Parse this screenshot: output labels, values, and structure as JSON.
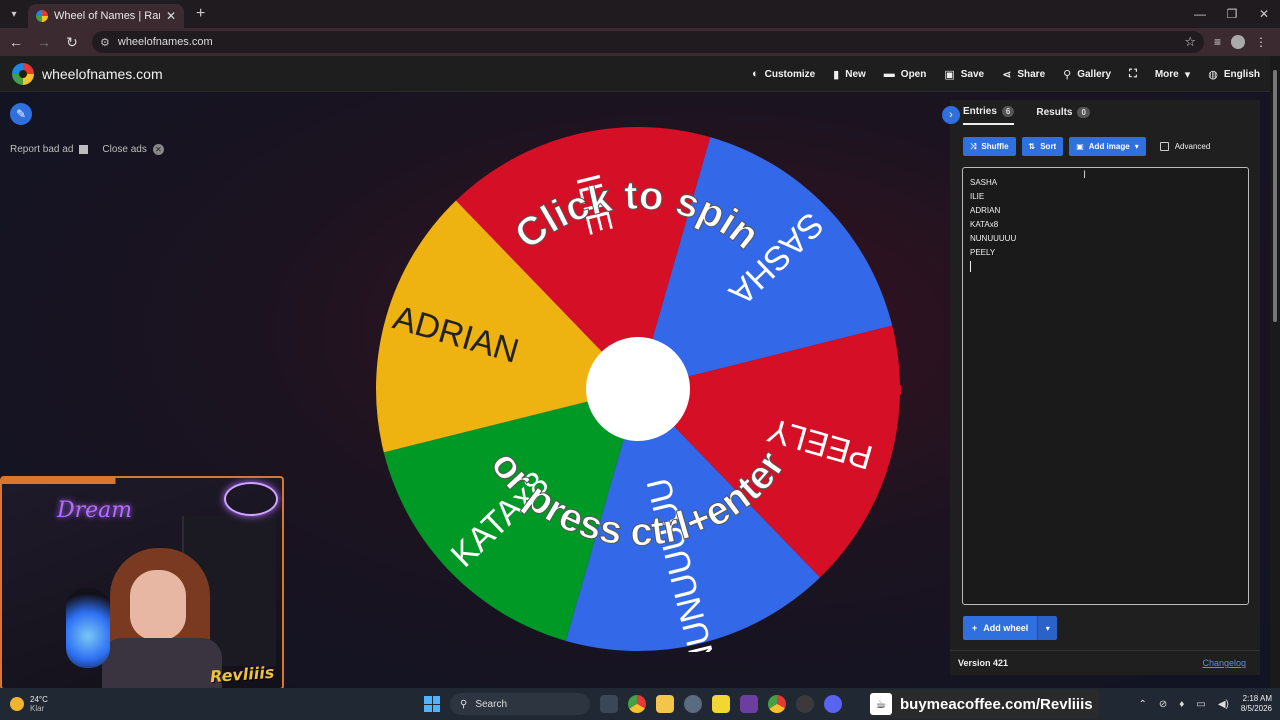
{
  "browser": {
    "tab_title": "Wheel of Names | Random name picker",
    "url": "wheelofnames.com",
    "new_tab_icon": "+",
    "window_controls": [
      "—",
      "❐",
      "✕"
    ]
  },
  "site": {
    "brand": "wheelofnames.com",
    "menu": [
      {
        "icon": "palette-icon",
        "glyph": "◐",
        "label": "Customize"
      },
      {
        "icon": "file-icon",
        "glyph": "▮",
        "label": "New"
      },
      {
        "icon": "folder-icon",
        "glyph": "▬",
        "label": "Open"
      },
      {
        "icon": "save-icon",
        "glyph": "▣",
        "label": "Save"
      },
      {
        "icon": "share-icon",
        "glyph": "⋖",
        "label": "Share"
      },
      {
        "icon": "search-icon",
        "glyph": "⚲",
        "label": "Gallery"
      },
      {
        "icon": "fullscreen-icon",
        "glyph": "⛶",
        "label": ""
      },
      {
        "icon": "chevron-down-icon",
        "glyph": "▾",
        "label": "More"
      },
      {
        "icon": "globe-icon",
        "glyph": "◍",
        "label": "English"
      }
    ]
  },
  "ads": {
    "report": "Report bad ad",
    "close": "Close ads"
  },
  "wheel": {
    "center_text_top": "Click to spin",
    "center_text_bottom": "or press ctrl+enter",
    "segments": [
      {
        "name": "SASHA",
        "color": "#3369e8"
      },
      {
        "name": "PEELY",
        "color": "#d50f25"
      },
      {
        "name": "NUNUUUUU",
        "color": "#3369e8"
      },
      {
        "name": "KATAx8",
        "color": "#009925"
      },
      {
        "name": "ADRIAN",
        "color": "#eeb211"
      },
      {
        "name": "ILIE",
        "color": "#d50f25"
      }
    ],
    "pointer_color": "#d50f25"
  },
  "panel": {
    "tabs": [
      {
        "label": "Entries",
        "count": "6"
      },
      {
        "label": "Results",
        "count": "0"
      }
    ],
    "buttons": {
      "shuffle": "Shuffle",
      "sort": "Sort",
      "add_image": "Add image",
      "advanced": "Advanced"
    },
    "entries": [
      "SASHA",
      "ILIE",
      "ADRIAN",
      "KATAx8",
      "NUNUUUUU",
      "PEELY"
    ],
    "add_wheel": "Add wheel",
    "version": "Version 421",
    "changelog": "Changelog"
  },
  "stream_overlay": {
    "neon_sign": "Dream",
    "badge": "Revliiis"
  },
  "taskbar": {
    "temperature": "24°C",
    "condition": "Klar",
    "search_placeholder": "Search",
    "buymeacoffee": "buymeacoffee.com/Revliiis",
    "time": "2:18 AM",
    "date": "8/5/2026"
  },
  "colors": {
    "accent_blue": "#2f6fde",
    "panel_bg": "#1f1f1f"
  }
}
